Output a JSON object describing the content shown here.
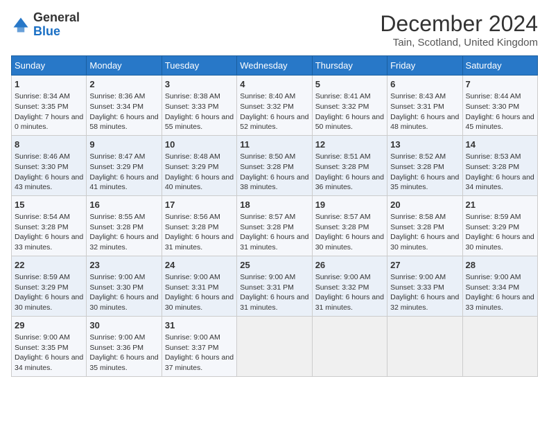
{
  "header": {
    "logo_general": "General",
    "logo_blue": "Blue",
    "title": "December 2024",
    "location": "Tain, Scotland, United Kingdom"
  },
  "days_of_week": [
    "Sunday",
    "Monday",
    "Tuesday",
    "Wednesday",
    "Thursday",
    "Friday",
    "Saturday"
  ],
  "weeks": [
    [
      {
        "day": "1",
        "info": "Sunrise: 8:34 AM\nSunset: 3:35 PM\nDaylight: 7 hours and 0 minutes."
      },
      {
        "day": "2",
        "info": "Sunrise: 8:36 AM\nSunset: 3:34 PM\nDaylight: 6 hours and 58 minutes."
      },
      {
        "day": "3",
        "info": "Sunrise: 8:38 AM\nSunset: 3:33 PM\nDaylight: 6 hours and 55 minutes."
      },
      {
        "day": "4",
        "info": "Sunrise: 8:40 AM\nSunset: 3:32 PM\nDaylight: 6 hours and 52 minutes."
      },
      {
        "day": "5",
        "info": "Sunrise: 8:41 AM\nSunset: 3:32 PM\nDaylight: 6 hours and 50 minutes."
      },
      {
        "day": "6",
        "info": "Sunrise: 8:43 AM\nSunset: 3:31 PM\nDaylight: 6 hours and 48 minutes."
      },
      {
        "day": "7",
        "info": "Sunrise: 8:44 AM\nSunset: 3:30 PM\nDaylight: 6 hours and 45 minutes."
      }
    ],
    [
      {
        "day": "8",
        "info": "Sunrise: 8:46 AM\nSunset: 3:30 PM\nDaylight: 6 hours and 43 minutes."
      },
      {
        "day": "9",
        "info": "Sunrise: 8:47 AM\nSunset: 3:29 PM\nDaylight: 6 hours and 41 minutes."
      },
      {
        "day": "10",
        "info": "Sunrise: 8:48 AM\nSunset: 3:29 PM\nDaylight: 6 hours and 40 minutes."
      },
      {
        "day": "11",
        "info": "Sunrise: 8:50 AM\nSunset: 3:28 PM\nDaylight: 6 hours and 38 minutes."
      },
      {
        "day": "12",
        "info": "Sunrise: 8:51 AM\nSunset: 3:28 PM\nDaylight: 6 hours and 36 minutes."
      },
      {
        "day": "13",
        "info": "Sunrise: 8:52 AM\nSunset: 3:28 PM\nDaylight: 6 hours and 35 minutes."
      },
      {
        "day": "14",
        "info": "Sunrise: 8:53 AM\nSunset: 3:28 PM\nDaylight: 6 hours and 34 minutes."
      }
    ],
    [
      {
        "day": "15",
        "info": "Sunrise: 8:54 AM\nSunset: 3:28 PM\nDaylight: 6 hours and 33 minutes."
      },
      {
        "day": "16",
        "info": "Sunrise: 8:55 AM\nSunset: 3:28 PM\nDaylight: 6 hours and 32 minutes."
      },
      {
        "day": "17",
        "info": "Sunrise: 8:56 AM\nSunset: 3:28 PM\nDaylight: 6 hours and 31 minutes."
      },
      {
        "day": "18",
        "info": "Sunrise: 8:57 AM\nSunset: 3:28 PM\nDaylight: 6 hours and 31 minutes."
      },
      {
        "day": "19",
        "info": "Sunrise: 8:57 AM\nSunset: 3:28 PM\nDaylight: 6 hours and 30 minutes."
      },
      {
        "day": "20",
        "info": "Sunrise: 8:58 AM\nSunset: 3:28 PM\nDaylight: 6 hours and 30 minutes."
      },
      {
        "day": "21",
        "info": "Sunrise: 8:59 AM\nSunset: 3:29 PM\nDaylight: 6 hours and 30 minutes."
      }
    ],
    [
      {
        "day": "22",
        "info": "Sunrise: 8:59 AM\nSunset: 3:29 PM\nDaylight: 6 hours and 30 minutes."
      },
      {
        "day": "23",
        "info": "Sunrise: 9:00 AM\nSunset: 3:30 PM\nDaylight: 6 hours and 30 minutes."
      },
      {
        "day": "24",
        "info": "Sunrise: 9:00 AM\nSunset: 3:31 PM\nDaylight: 6 hours and 30 minutes."
      },
      {
        "day": "25",
        "info": "Sunrise: 9:00 AM\nSunset: 3:31 PM\nDaylight: 6 hours and 31 minutes."
      },
      {
        "day": "26",
        "info": "Sunrise: 9:00 AM\nSunset: 3:32 PM\nDaylight: 6 hours and 31 minutes."
      },
      {
        "day": "27",
        "info": "Sunrise: 9:00 AM\nSunset: 3:33 PM\nDaylight: 6 hours and 32 minutes."
      },
      {
        "day": "28",
        "info": "Sunrise: 9:00 AM\nSunset: 3:34 PM\nDaylight: 6 hours and 33 minutes."
      }
    ],
    [
      {
        "day": "29",
        "info": "Sunrise: 9:00 AM\nSunset: 3:35 PM\nDaylight: 6 hours and 34 minutes."
      },
      {
        "day": "30",
        "info": "Sunrise: 9:00 AM\nSunset: 3:36 PM\nDaylight: 6 hours and 35 minutes."
      },
      {
        "day": "31",
        "info": "Sunrise: 9:00 AM\nSunset: 3:37 PM\nDaylight: 6 hours and 37 minutes."
      },
      null,
      null,
      null,
      null
    ]
  ]
}
